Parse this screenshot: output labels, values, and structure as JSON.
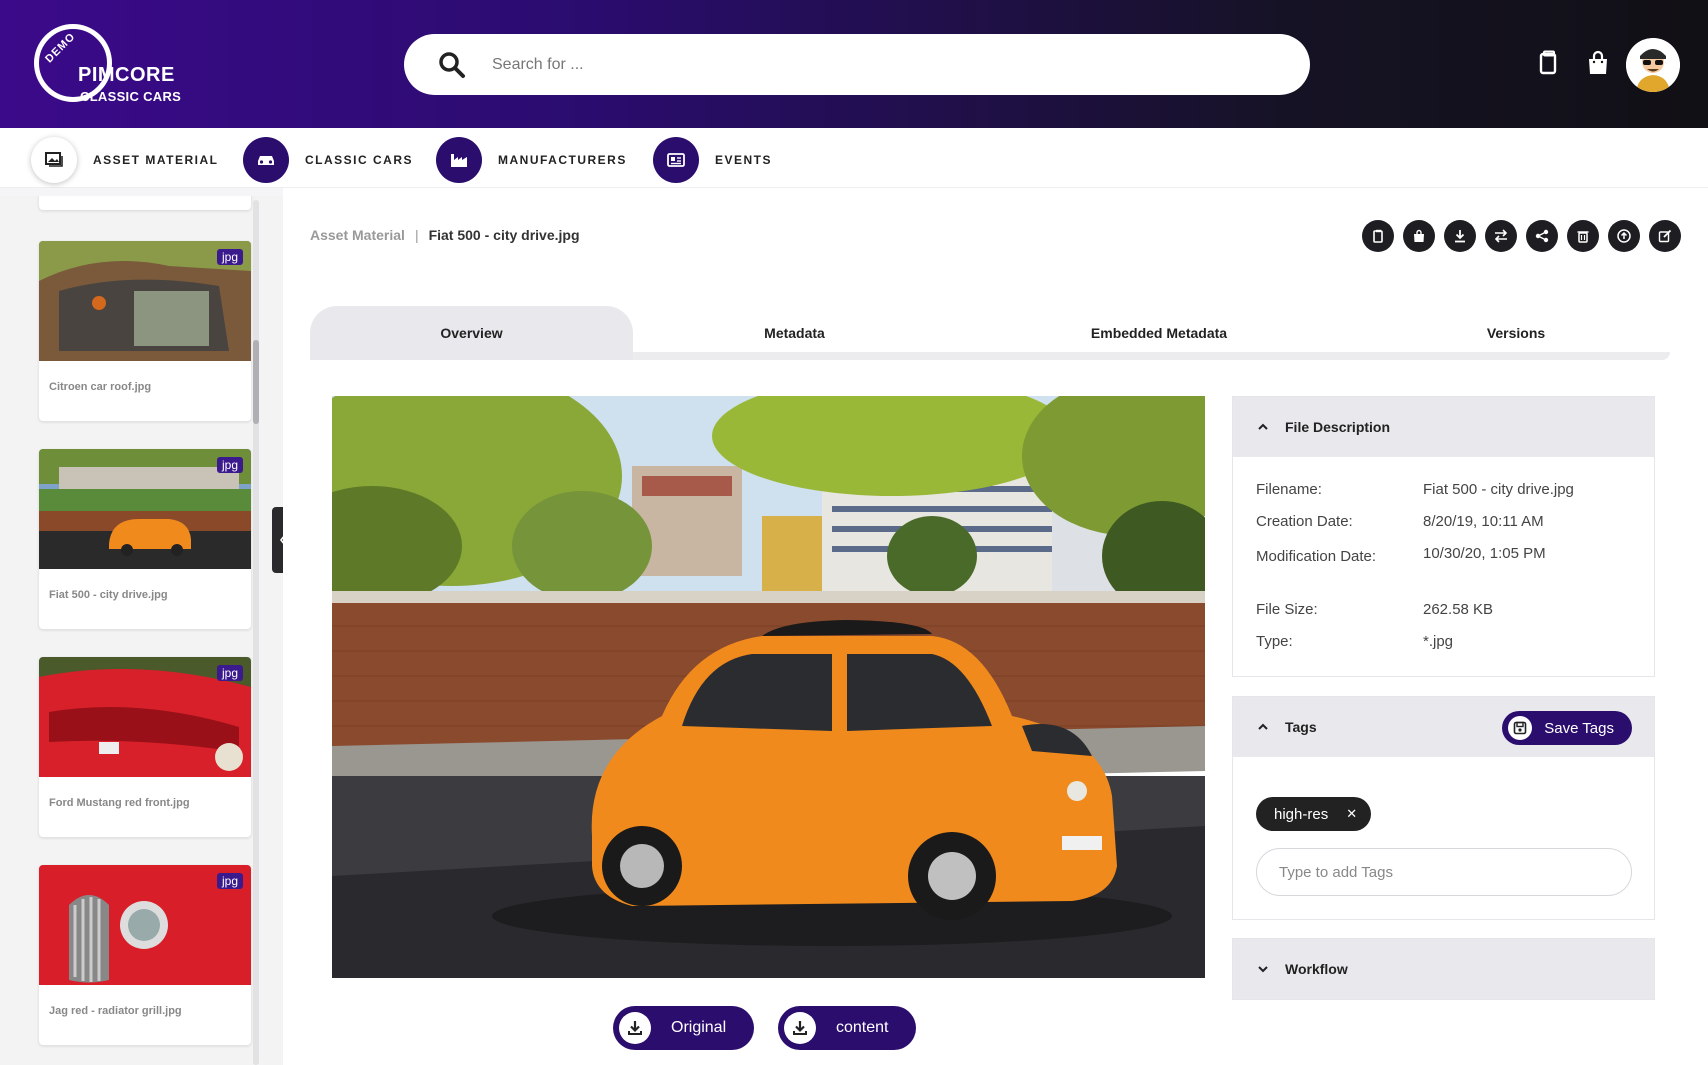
{
  "header": {
    "logo": {
      "demo": "DEMO",
      "brand": "PIMCORE",
      "sub": "CLASSIC CARS"
    },
    "search": {
      "placeholder": "Search for ..."
    }
  },
  "nav": {
    "items": [
      {
        "label": "ASSET MATERIAL",
        "icon": "image-gallery-icon",
        "active": true
      },
      {
        "label": "CLASSIC CARS",
        "icon": "car-icon",
        "active": false
      },
      {
        "label": "MANUFACTURERS",
        "icon": "factory-icon",
        "active": false
      },
      {
        "label": "EVENTS",
        "icon": "newspaper-icon",
        "active": false
      }
    ]
  },
  "sidebar": {
    "cards": [
      {
        "label": "Citroen car roof.jpg",
        "badge": "jpg"
      },
      {
        "label": "Fiat 500 - city drive.jpg",
        "badge": "jpg"
      },
      {
        "label": "Ford Mustang red front.jpg",
        "badge": "jpg"
      },
      {
        "label": "Jag red - radiator grill.jpg",
        "badge": "jpg"
      }
    ]
  },
  "breadcrumb": {
    "parent": "Asset Material",
    "separator": "|",
    "current": "Fiat 500 - city drive.jpg"
  },
  "actions": [
    "copy-icon",
    "bag-icon",
    "download-icon",
    "swap-icon",
    "share-icon",
    "trash-icon",
    "upload-icon",
    "edit-icon"
  ],
  "tabs": [
    {
      "label": "Overview",
      "active": true
    },
    {
      "label": "Metadata",
      "active": false
    },
    {
      "label": "Embedded Metadata",
      "active": false
    },
    {
      "label": "Versions",
      "active": false
    }
  ],
  "downloads": {
    "original": "Original",
    "content": "content"
  },
  "file_description": {
    "title": "File Description",
    "rows": [
      {
        "label": "Filename:",
        "value": "Fiat 500 - city drive.jpg"
      },
      {
        "label": "Creation Date:",
        "value": "8/20/19, 10:11 AM"
      },
      {
        "label": "Modification Date:",
        "value": "10/30/20, 1:05 PM"
      },
      {
        "label": "File Size:",
        "value": "262.58 KB"
      },
      {
        "label": "Type:",
        "value": "*.jpg"
      }
    ]
  },
  "tags": {
    "title": "Tags",
    "save_label": "Save Tags",
    "chips": [
      "high-res"
    ],
    "input_placeholder": "Type to add Tags"
  },
  "workflow": {
    "title": "Workflow"
  },
  "colors": {
    "brand": "#2b0d6e",
    "header_start": "#3b0a8a",
    "header_end": "#111014",
    "accent_car": "#f08a1c"
  }
}
